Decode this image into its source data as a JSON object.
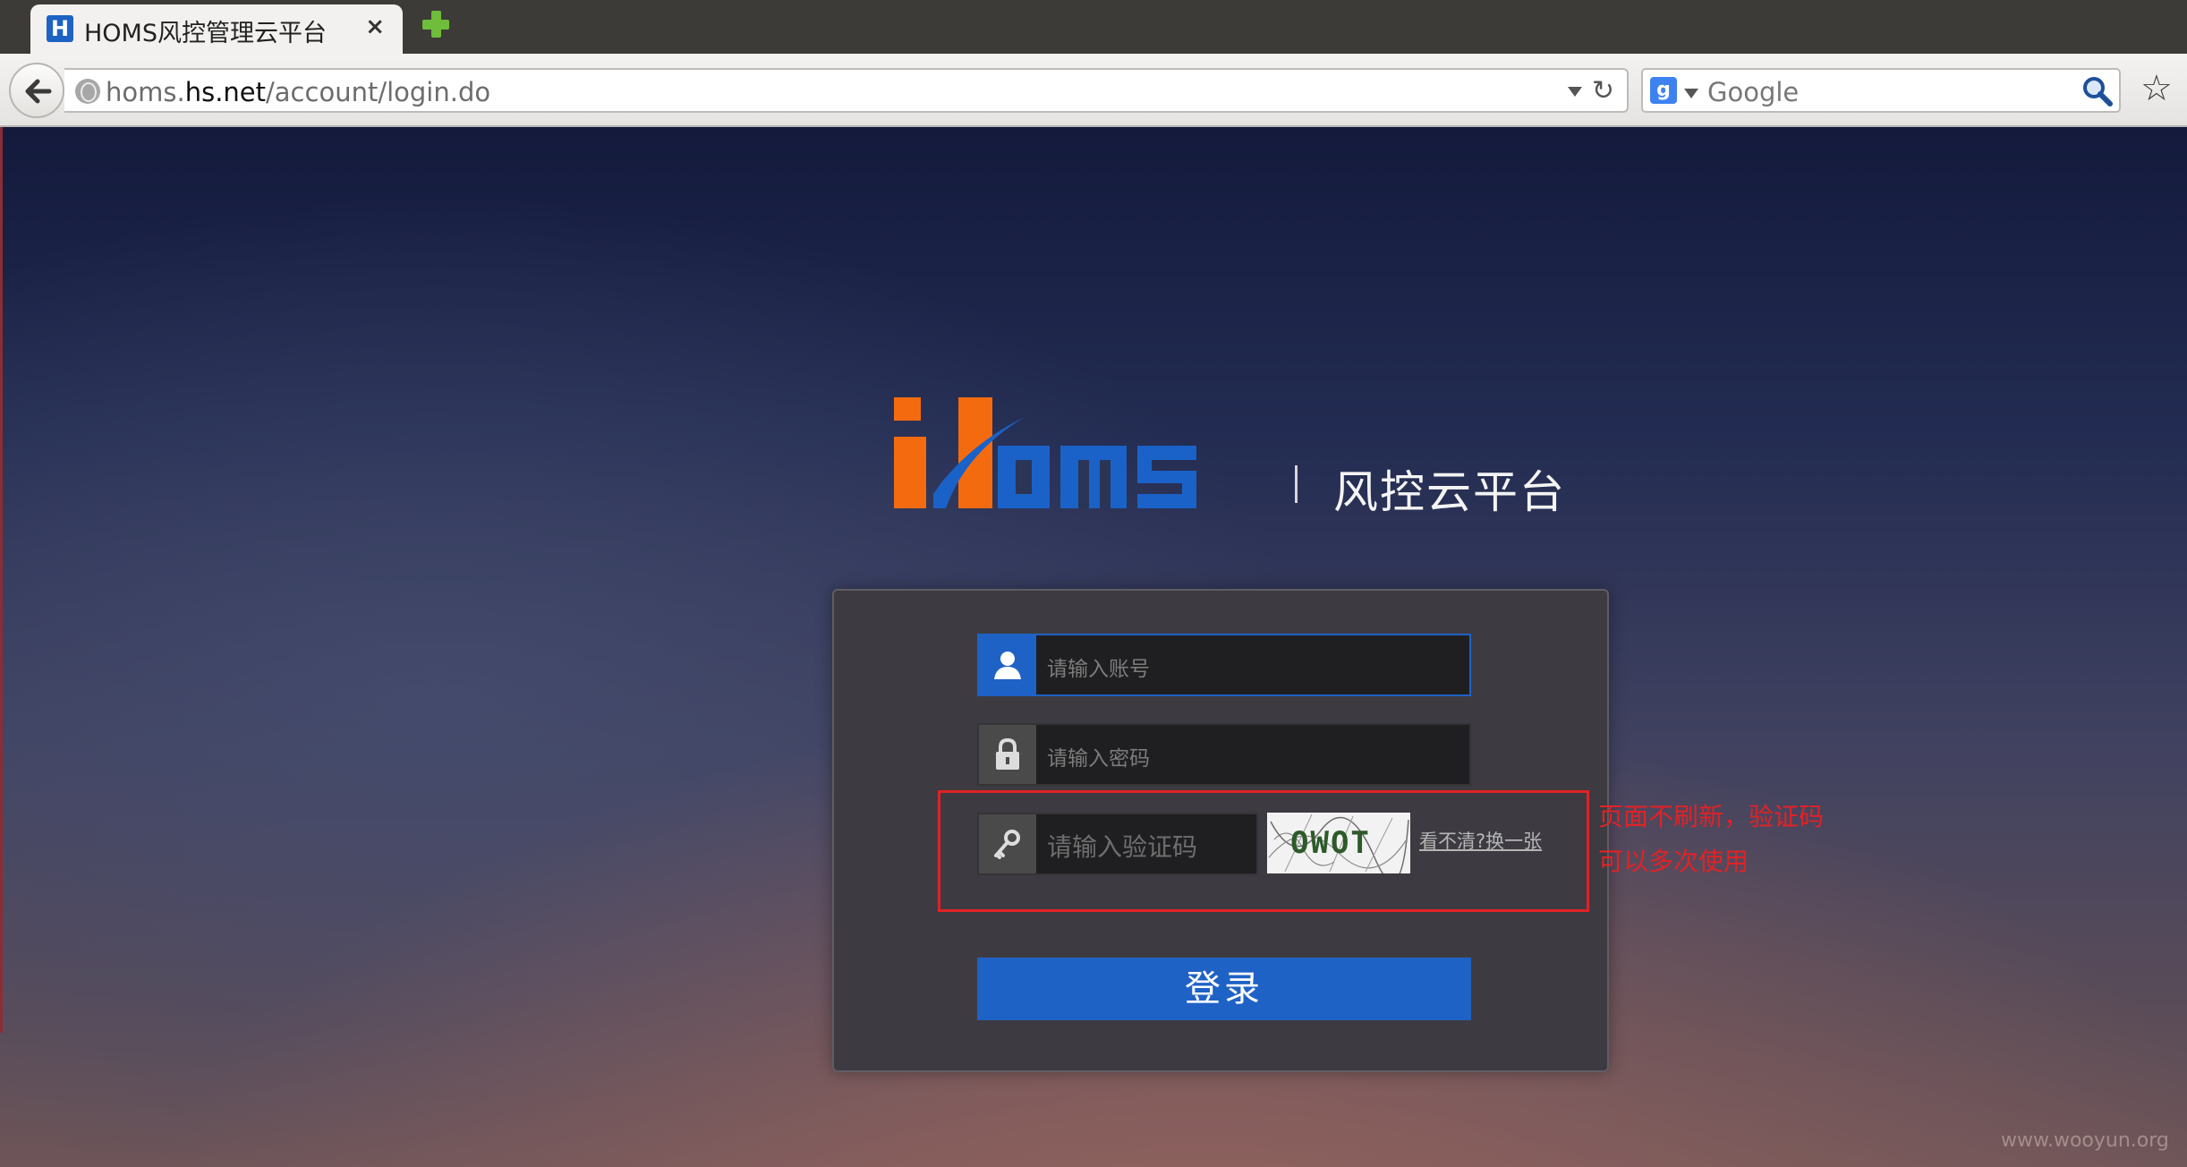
{
  "browser": {
    "tab_icon": "H",
    "tab_title": "HOMS风控管理云平台",
    "tab_close": "×",
    "url_prefix": "homs.",
    "url_domain": "hs.net",
    "url_path": "/account/login.do",
    "search_engine_icon": "g",
    "search_placeholder": "Google",
    "reload_glyph": "↻",
    "star_glyph": "☆"
  },
  "logo": {
    "subtitle": "风控云平台"
  },
  "login": {
    "username_placeholder": "请输入账号",
    "password_placeholder": "请输入密码",
    "captcha_placeholder": "请输入验证码",
    "captcha_text": "OWOT",
    "captcha_refresh": "看不清?换一张",
    "submit_label": "登录"
  },
  "annotation": {
    "line1": "页面不刷新，验证码",
    "line2": "可以多次使用"
  },
  "watermark": "www.wooyun.org",
  "colors": {
    "accent_blue": "#1f62c6",
    "logo_orange": "#f46b0f",
    "annotation_red": "#e12226"
  }
}
